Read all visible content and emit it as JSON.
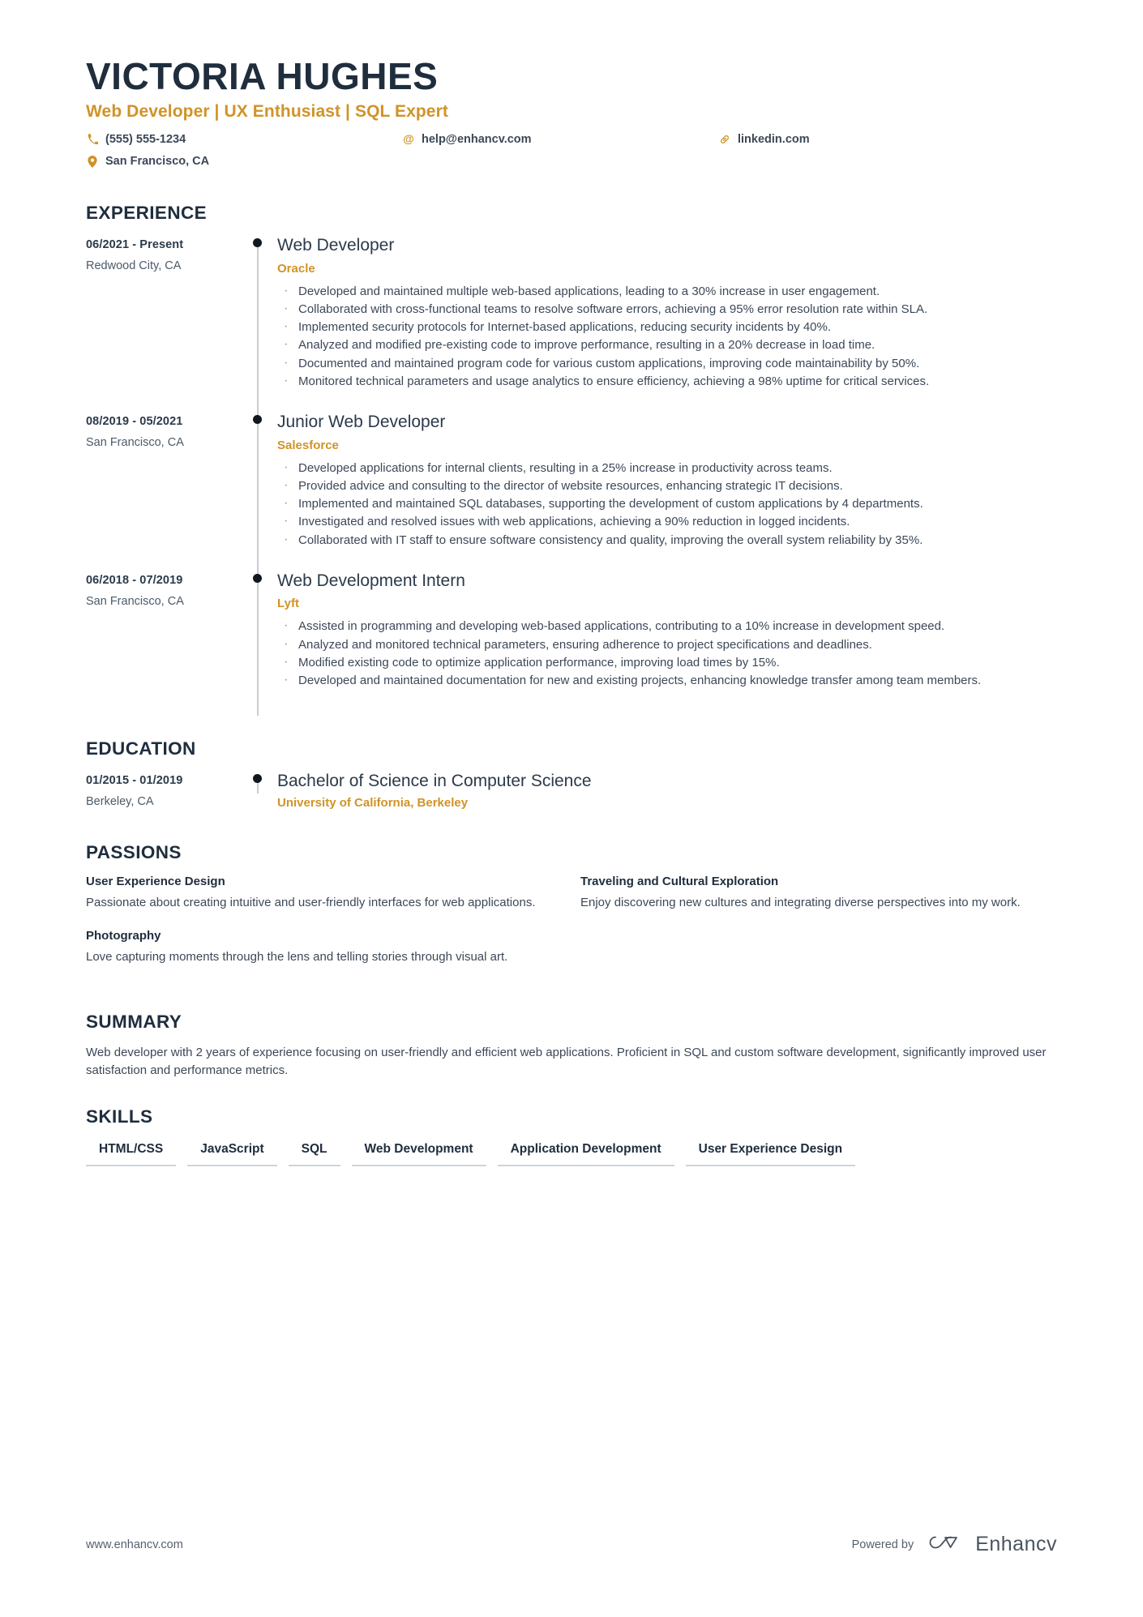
{
  "header": {
    "name": "VICTORIA HUGHES",
    "headline": "Web Developer | UX Enthusiast | SQL Expert",
    "contacts": [
      {
        "icon": "phone-icon",
        "text": "(555) 555-1234"
      },
      {
        "icon": "location-pin-icon",
        "text": "San Francisco, CA"
      },
      {
        "icon": "email-icon",
        "text": "help@enhancv.com"
      },
      {
        "icon": "link-icon",
        "text": "linkedin.com"
      }
    ]
  },
  "sections": {
    "experience_title": "EXPERIENCE",
    "education_title": "EDUCATION",
    "passions_title": "PASSIONS",
    "summary_title": "SUMMARY",
    "skills_title": "SKILLS"
  },
  "experience": [
    {
      "date": "06/2021 - Present",
      "location": "Redwood City, CA",
      "role": "Web Developer",
      "company": "Oracle",
      "bullets": [
        "Developed and maintained multiple web-based applications, leading to a 30% increase in user engagement.",
        "Collaborated with cross-functional teams to resolve software errors, achieving a 95% error resolution rate within SLA.",
        "Implemented security protocols for Internet-based applications, reducing security incidents by 40%.",
        "Analyzed and modified pre-existing code to improve performance, resulting in a 20% decrease in load time.",
        "Documented and maintained program code for various custom applications, improving code maintainability by 50%.",
        "Monitored technical parameters and usage analytics to ensure efficiency, achieving a 98% uptime for critical services."
      ]
    },
    {
      "date": "08/2019 - 05/2021",
      "location": "San Francisco, CA",
      "role": "Junior Web Developer",
      "company": "Salesforce",
      "bullets": [
        "Developed applications for internal clients, resulting in a 25% increase in productivity across teams.",
        "Provided advice and consulting to the director of website resources, enhancing strategic IT decisions.",
        "Implemented and maintained SQL databases, supporting the development of custom applications by 4 departments.",
        "Investigated and resolved issues with web applications, achieving a 90% reduction in logged incidents.",
        "Collaborated with IT staff to ensure software consistency and quality, improving the overall system reliability by 35%."
      ]
    },
    {
      "date": "06/2018 - 07/2019",
      "location": "San Francisco, CA",
      "role": "Web Development Intern",
      "company": "Lyft",
      "bullets": [
        "Assisted in programming and developing web-based applications, contributing to a 10% increase in development speed.",
        "Analyzed and monitored technical parameters, ensuring adherence to project specifications and deadlines.",
        "Modified existing code to optimize application performance, improving load times by 15%.",
        "Developed and maintained documentation for new and existing projects, enhancing knowledge transfer among team members."
      ]
    }
  ],
  "education": [
    {
      "date": "01/2015 - 01/2019",
      "location": "Berkeley, CA",
      "degree": "Bachelor of Science in Computer Science",
      "school": "University of California, Berkeley"
    }
  ],
  "passions": [
    {
      "title": "User Experience Design",
      "description": "Passionate about creating intuitive and user-friendly interfaces for web applications."
    },
    {
      "title": "Traveling and Cultural Exploration",
      "description": "Enjoy discovering new cultures and integrating diverse perspectives into my work."
    },
    {
      "title": "Photography",
      "description": "Love capturing moments through the lens and telling stories through visual art."
    }
  ],
  "summary": "Web developer with 2 years of experience focusing on user-friendly and efficient web applications. Proficient in SQL and custom software development, significantly improved user satisfaction and performance metrics.",
  "skills": [
    "HTML/CSS",
    "JavaScript",
    "SQL",
    "Web Development",
    "Application Development",
    "User Experience Design"
  ],
  "footer": {
    "url": "www.enhancv.com",
    "powered_by": "Powered by",
    "brand": "Enhancv"
  },
  "colors": {
    "accent": "#d09328",
    "ink": "#1f2d3d",
    "body": "#3c4858",
    "rule": "#cfd4da"
  }
}
